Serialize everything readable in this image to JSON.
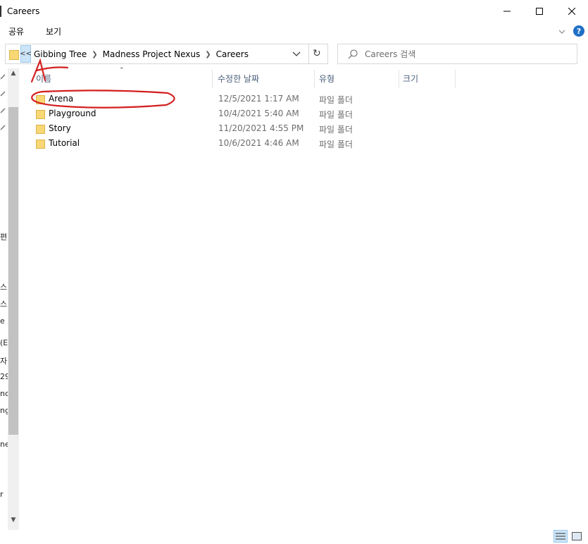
{
  "window": {
    "title": "Careers"
  },
  "ribbon": {
    "tabs": [
      "공유",
      "보기"
    ]
  },
  "address": {
    "overflow": "<<",
    "crumbs": [
      "Gibbing Tree",
      "Madness Project Nexus",
      "Careers"
    ]
  },
  "search": {
    "placeholder": "Careers 검색"
  },
  "columns": {
    "name": "이름",
    "date": "수정한 날짜",
    "type": "유형",
    "size": "크기"
  },
  "files": [
    {
      "name": "Arena",
      "date": "12/5/2021 1:17 AM",
      "type": "파일 폴더"
    },
    {
      "name": "Playground",
      "date": "10/4/2021 5:40 AM",
      "type": "파일 폴더"
    },
    {
      "name": "Story",
      "date": "11/20/2021 4:55 PM",
      "type": "파일 폴더"
    },
    {
      "name": "Tutorial",
      "date": "10/6/2021 4:46 AM",
      "type": "파일 폴더"
    }
  ],
  "navpane_fragments": [
    "편",
    "스",
    "스",
    "e (",
    "(E",
    "자",
    "29",
    "nc",
    "ng",
    "ne",
    "r"
  ],
  "annotation": {
    "letter": "A",
    "color": "#d42020"
  },
  "colors": {
    "accent": "#1f6fc5",
    "folder": "#f8d775",
    "selection": "#cce4f7"
  }
}
